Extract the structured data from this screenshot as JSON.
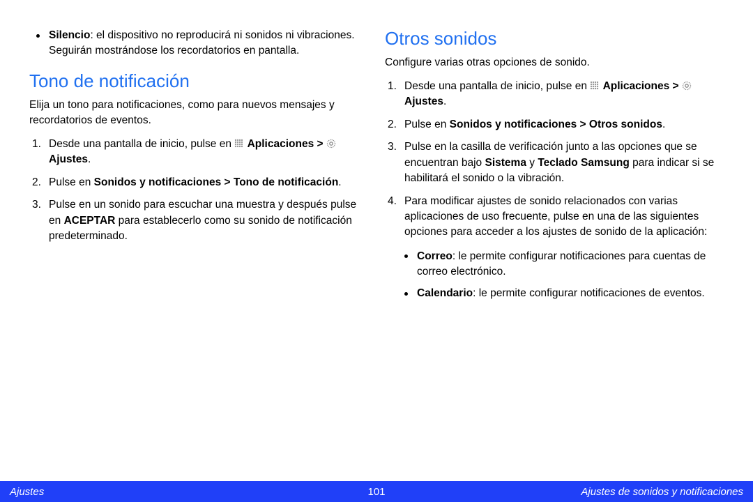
{
  "left": {
    "silencio": {
      "label": "Silencio",
      "text": ": el dispositivo no reproducirá ni sonidos ni vibraciones. Seguirán mostrándose los recordatorios en pantalla."
    },
    "heading": "Tono de notificación",
    "intro": "Elija un tono para notificaciones, como para nuevos mensajes y recordatorios de eventos.",
    "step1_a": "Desde una pantalla de inicio, pulse en ",
    "step1_b": "Aplicaciones > ",
    "step1_c": " Ajustes",
    "step1_d": ".",
    "step2_a": "Pulse en ",
    "step2_b": "Sonidos y notificaciones > Tono de notificación",
    "step2_c": ".",
    "step3_a": "Pulse en un sonido para escuchar una muestra y después pulse en ",
    "step3_b": "ACEPTAR",
    "step3_c": " para establecerlo como su sonido de notificación predeterminado."
  },
  "right": {
    "heading": "Otros sonidos",
    "intro": "Configure varias otras opciones de sonido.",
    "step1_a": "Desde una pantalla de inicio, pulse en ",
    "step1_b": "Aplicaciones > ",
    "step1_c": " Ajustes",
    "step1_d": ".",
    "step2_a": "Pulse en ",
    "step2_b": "Sonidos y notificaciones > Otros sonidos",
    "step2_c": ".",
    "step3_a": "Pulse en la casilla de verificación junto a las opciones que se encuentran bajo ",
    "step3_b": "Sistema",
    "step3_c": " y ",
    "step3_d": "Teclado Samsung",
    "step3_e": " para indicar si se habilitará el sonido o la vibración.",
    "step4": "Para modificar ajustes de sonido relacionados con varias aplicaciones de uso frecuente, pulse en una de las siguientes opciones para acceder a los ajustes de sonido de la aplicación:",
    "sub1_label": "Correo",
    "sub1_text": ": le permite configurar notificaciones para cuentas de correo electrónico.",
    "sub2_label": "Calendario",
    "sub2_text": ": le permite configurar notificaciones de eventos."
  },
  "footer": {
    "left": "Ajustes",
    "center": "101",
    "right": "Ajustes de sonidos y notificaciones"
  }
}
